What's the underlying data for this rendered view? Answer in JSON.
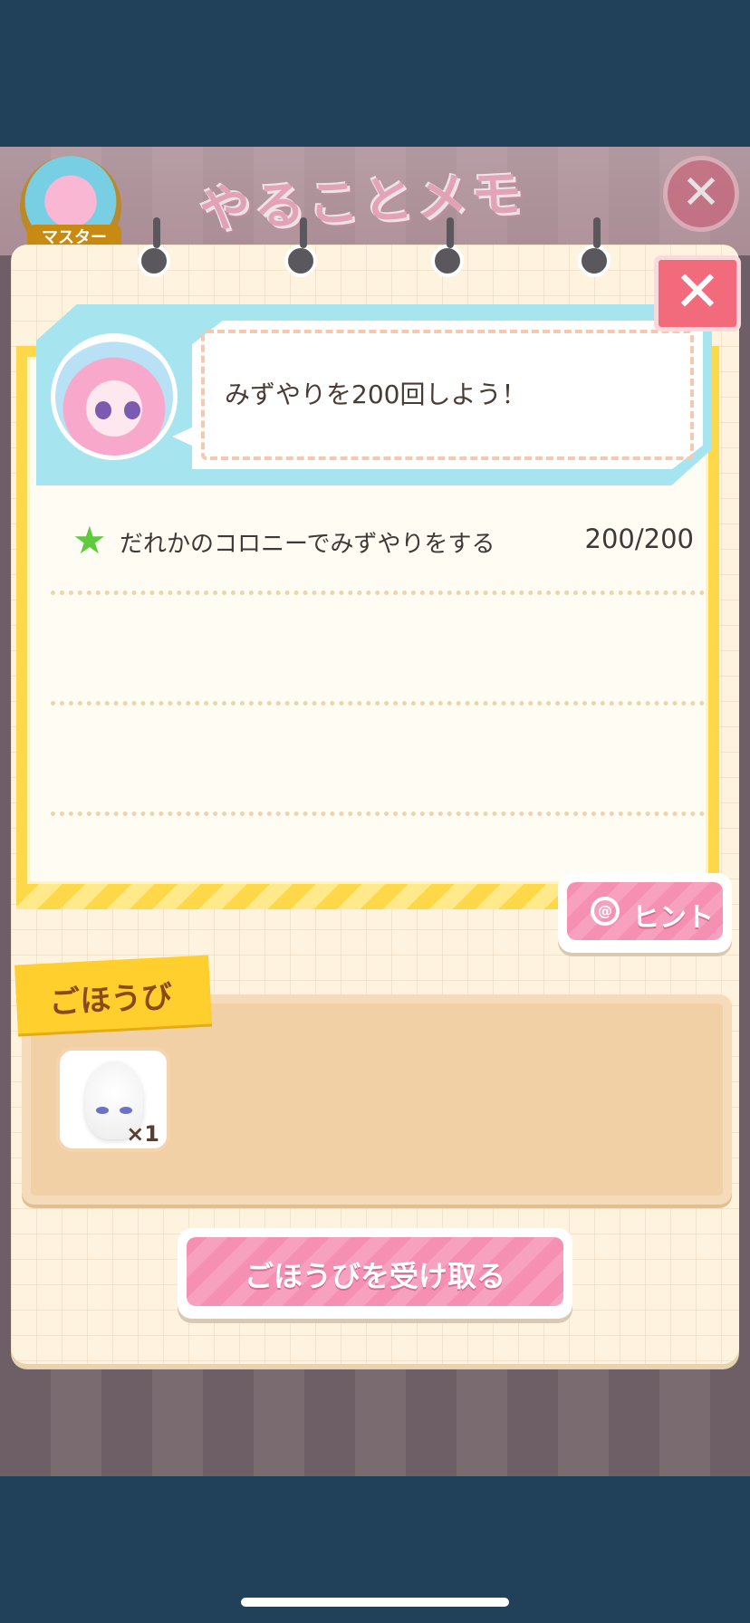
{
  "background": {
    "master_badge_label": "マスター",
    "title_logo": "やることメモ",
    "close_glyph": "✕"
  },
  "mission": {
    "message": "みずやりを200回しよう！",
    "tasks": [
      {
        "icon": "star-icon",
        "label": "だれかのコロニーでみずやりをする",
        "progress": "200/200"
      }
    ],
    "hint_label": "ヒント"
  },
  "reward": {
    "tag_label": "ごほうび",
    "items": [
      {
        "icon": "white-drop-character",
        "quantity": "×1"
      }
    ],
    "receive_label": "ごほうびを受け取る"
  },
  "dialog": {
    "close_glyph": "✕"
  },
  "colors": {
    "accent_pink": "#f590b2",
    "tape_yellow": "#ffd84a",
    "header_blue": "#a6e4ef",
    "star_green": "#5ecb3f"
  }
}
